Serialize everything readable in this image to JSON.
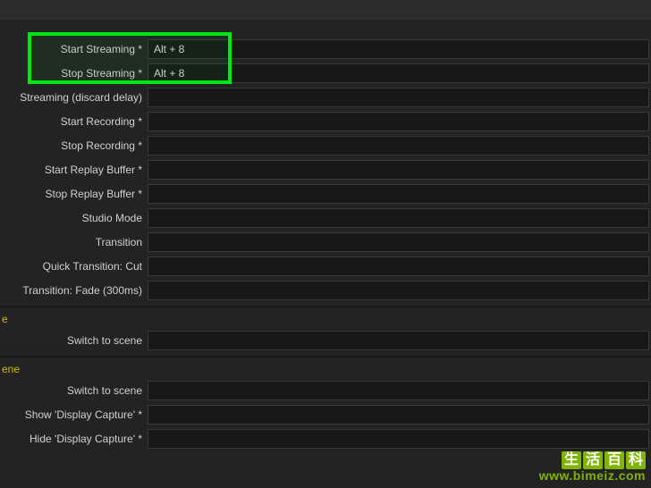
{
  "sections": {
    "main": {
      "rows": [
        {
          "label": "Start Streaming *",
          "value": "Alt + 8"
        },
        {
          "label": "Stop Streaming *",
          "value": "Alt + 8"
        },
        {
          "label": "Streaming (discard delay)",
          "value": ""
        },
        {
          "label": "Start Recording *",
          "value": ""
        },
        {
          "label": "Stop Recording *",
          "value": ""
        },
        {
          "label": "Start Replay Buffer *",
          "value": ""
        },
        {
          "label": "Stop Replay Buffer *",
          "value": ""
        },
        {
          "label": "Studio Mode",
          "value": ""
        },
        {
          "label": "Transition",
          "value": ""
        },
        {
          "label": "Quick Transition: Cut",
          "value": ""
        },
        {
          "label": "Transition: Fade (300ms)",
          "value": ""
        }
      ]
    },
    "scene1": {
      "header": "e",
      "rows": [
        {
          "label": "Switch to scene",
          "value": ""
        }
      ]
    },
    "scene2": {
      "header": "ene",
      "rows": [
        {
          "label": "Switch to scene",
          "value": ""
        },
        {
          "label": "Show 'Display Capture' *",
          "value": ""
        },
        {
          "label": "Hide 'Display Capture' *",
          "value": ""
        }
      ]
    }
  },
  "watermark": {
    "brand_chars": [
      "生",
      "活",
      "百",
      "科"
    ],
    "url": "www.bimeiz.com"
  }
}
